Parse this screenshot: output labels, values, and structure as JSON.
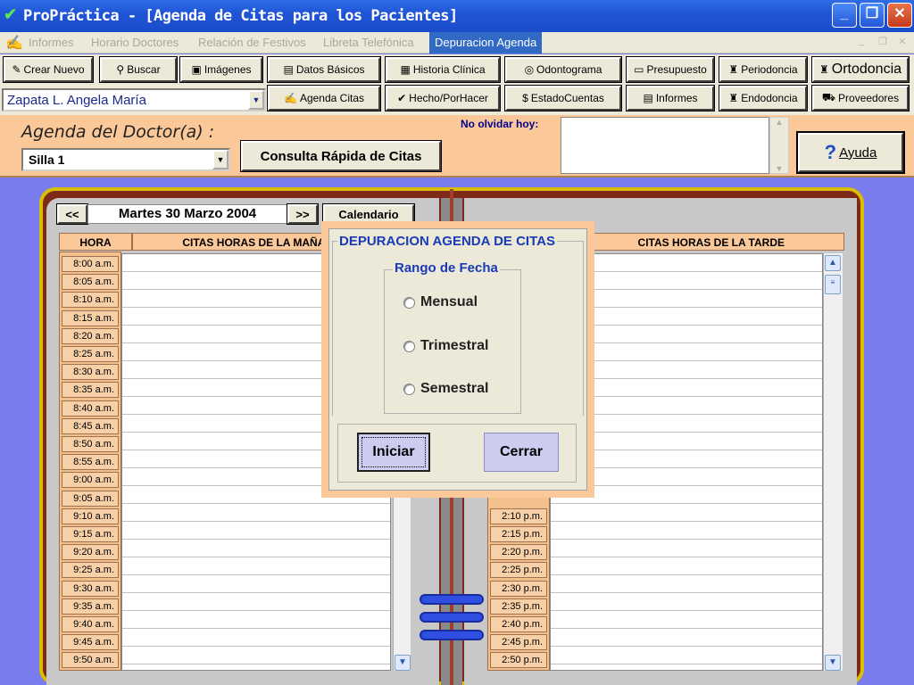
{
  "window": {
    "title": "ProPráctica - [Agenda de Citas para los Pacientes]",
    "controls": [
      "_",
      "❐",
      "✕"
    ]
  },
  "menu": {
    "items": [
      "Informes",
      "Horario Doctores",
      "Relación de Festivos",
      "Libreta Telefónica",
      "Depuracion Agenda"
    ],
    "active": "Depuracion Agenda"
  },
  "toolbar": {
    "row1": [
      "Crear Nuevo",
      "Buscar",
      "Imágenes",
      "Datos Básicos",
      "Historia Clínica",
      "Odontograma",
      "Presupuesto",
      "Periodoncia",
      "Ortodoncia"
    ],
    "row2": [
      "Agenda Citas",
      "Hecho/PorHacer",
      "EstadoCuentas",
      "Informes",
      "Endodoncia",
      "Proveedores"
    ],
    "patient": "Zapata L. Angela María"
  },
  "header": {
    "agenda_label": "Agenda del Doctor(a) :",
    "silla": "Silla 1",
    "consulta": "Consulta Rápida de Citas",
    "no_olvidar": "No olvidar hoy:",
    "ayuda": "Ayuda"
  },
  "agenda": {
    "prev": "<<",
    "next": ">>",
    "date": "Martes 30 Marzo 2004",
    "calendario": "Calendario",
    "hora_header": "HORA",
    "morning_header": "CITAS HORAS DE LA MAÑANA",
    "afternoon_header": "CITAS HORAS DE LA TARDE",
    "morning_slots": [
      "8:00 a.m.",
      "8:05 a.m.",
      "8:10 a.m.",
      "8:15 a.m.",
      "8:20 a.m.",
      "8:25 a.m.",
      "8:30 a.m.",
      "8:35 a.m.",
      "8:40 a.m.",
      "8:45 a.m.",
      "8:50 a.m.",
      "8:55 a.m.",
      "9:00 a.m.",
      "9:05 a.m.",
      "9:10 a.m.",
      "9:15 a.m.",
      "9:20 a.m.",
      "9:25 a.m.",
      "9:30 a.m.",
      "9:35 a.m.",
      "9:40 a.m.",
      "9:45 a.m.",
      "9:50 a.m."
    ],
    "afternoon_slots": [
      "2:10 p.m.",
      "2:15 p.m.",
      "2:20 p.m.",
      "2:25 p.m.",
      "2:30 p.m.",
      "2:35 p.m.",
      "2:40 p.m.",
      "2:45 p.m.",
      "2:50 p.m."
    ]
  },
  "dialog": {
    "title": "DEPURACION AGENDA DE CITAS",
    "group_title": "Rango de Fecha",
    "options": [
      "Mensual",
      "Trimestral",
      "Semestral"
    ],
    "start": "Iniciar",
    "close": "Cerrar"
  },
  "colors": {
    "titlebar": "#1f55d6",
    "background": "#7b7bf0",
    "header_orange": "#fbc89a",
    "dialog_title": "#1a3ab8",
    "book_frame": "#7f2a18"
  }
}
